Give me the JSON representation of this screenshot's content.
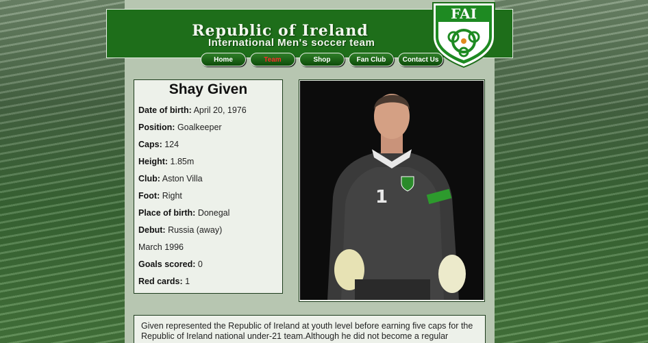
{
  "header": {
    "title": "Republic of Ireland",
    "subtitle": "International Men's soccer team",
    "logo_text": "FAI"
  },
  "nav": [
    {
      "label": "Home",
      "active": false
    },
    {
      "label": "Team",
      "active": true
    },
    {
      "label": "Shop",
      "active": false
    },
    {
      "label": "Fan Club",
      "active": false
    },
    {
      "label": "Contact Us",
      "active": false
    }
  ],
  "player": {
    "name": "Shay Given",
    "stats": [
      {
        "label": "Date of birth:",
        "value": "April 20, 1976"
      },
      {
        "label": "Position:",
        "value": "Goalkeeper"
      },
      {
        "label": "Caps:",
        "value": "124"
      },
      {
        "label": "Height:",
        "value": "1.85m"
      },
      {
        "label": "Club:",
        "value": "Aston Villa"
      },
      {
        "label": "Foot:",
        "value": "Right"
      },
      {
        "label": "Place of birth:",
        "value": "Donegal"
      },
      {
        "label": "Debut:",
        "value": "Russia (away)"
      },
      {
        "label": "",
        "value": "March 1996"
      },
      {
        "label": "Goals scored:",
        "value": "0"
      },
      {
        "label": "Red cards:",
        "value": "1"
      }
    ],
    "bio": "Given represented the Republic of Ireland at youth level before earning five caps for the Republic of Ireland national under-21 team.Although he did not become a regular"
  },
  "colors": {
    "header_green": "#1e6e1a",
    "active_nav": "#ff2a2a",
    "panel_bg": "#edf1ea"
  }
}
